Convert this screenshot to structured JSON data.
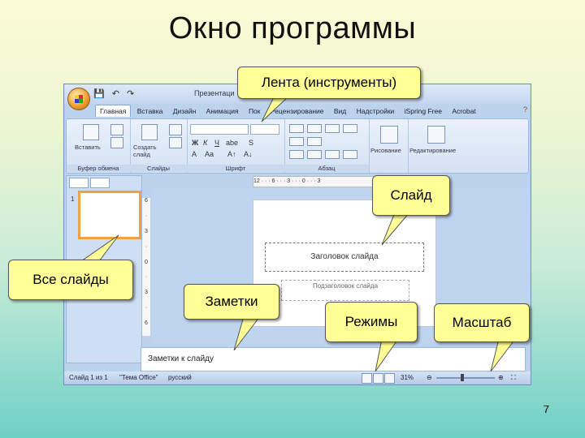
{
  "slide": {
    "title": "Окно программы",
    "page_number": "7"
  },
  "window": {
    "title": "Презентаци",
    "quick_access": [
      "💾",
      "↶",
      "↷"
    ],
    "ribbon_tabs": [
      "Главная",
      "Вставка",
      "Дизайн",
      "Анимация",
      "Пок",
      "Рецензирование",
      "Вид",
      "Надстройки",
      "iSpring Free",
      "Acrobat"
    ],
    "ribbon": {
      "groups": {
        "clipboard": {
          "label": "Буфер обмена",
          "button": "Вставить"
        },
        "slides": {
          "label": "Слайды",
          "button": "Создать слайд"
        },
        "font": {
          "label": "Шрифт"
        },
        "paragraph": {
          "label": "Абзац"
        },
        "drawing": {
          "label": "Рисование"
        },
        "editing": {
          "label": "Редактирование"
        }
      }
    },
    "ruler_h": "12 · · · 6 · · · 3 · · · 0 · · · 3",
    "ruler_v": "6 · 3 · 0 · 3 · 6",
    "thumbnail_number": "1",
    "slide_title_placeholder": "Заголовок слайда",
    "slide_subtitle_placeholder": "Подзаголовок слайда",
    "notes_placeholder": "Заметки к слайду",
    "status": {
      "slide_counter": "Слайд 1 из 1",
      "theme": "\"Тема Office\"",
      "language": "русский",
      "zoom": "31%"
    }
  },
  "callouts": {
    "ribbon": "Лента (инструменты)",
    "slide": "Слайд",
    "all_slides": "Все слайды",
    "notes": "Заметки",
    "views": "Режимы",
    "zoom": "Масштаб"
  },
  "colors": {
    "callout_fill": "#ffff96",
    "window_frame": "#bcd3ee",
    "thumbnail_highlight": "#f0a040"
  }
}
